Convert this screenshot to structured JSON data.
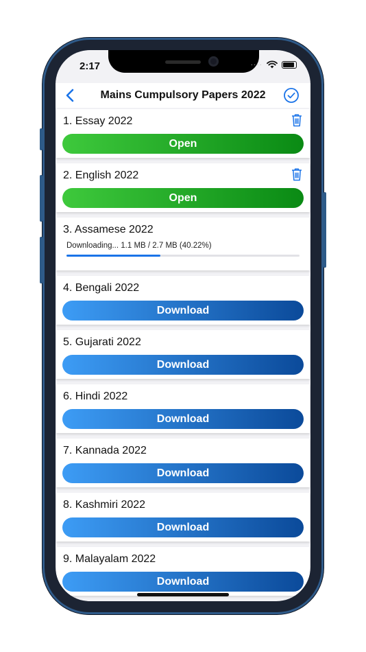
{
  "status": {
    "time": "2:17",
    "signal": "····"
  },
  "header": {
    "title": "Mains Cumpulsory Papers 2022"
  },
  "papers": [
    {
      "title": "1.  Essay 2022",
      "state": "open",
      "button": "Open"
    },
    {
      "title": "2.  English 2022",
      "state": "open",
      "button": "Open"
    },
    {
      "title": "3.  Assamese 2022",
      "state": "downloading",
      "progress_text": "Downloading... 1.1 MB / 2.7 MB (40.22%)",
      "progress": 0.4022
    },
    {
      "title": "4.  Bengali 2022",
      "state": "download",
      "button": "Download"
    },
    {
      "title": "5.  Gujarati 2022",
      "state": "download",
      "button": "Download"
    },
    {
      "title": "6.  Hindi 2022",
      "state": "download",
      "button": "Download"
    },
    {
      "title": "7.  Kannada 2022",
      "state": "download",
      "button": "Download"
    },
    {
      "title": "8.  Kashmiri 2022",
      "state": "download",
      "button": "Download"
    },
    {
      "title": "9.  Malayalam 2022",
      "state": "download",
      "button": "Download"
    }
  ],
  "colors": {
    "accent": "#1a73e8",
    "open_start": "#3ec93c",
    "open_end": "#0a8a14",
    "download_start": "#3d9cf5",
    "download_end": "#0b4a9a",
    "frame": "#2f5b8a"
  },
  "icons": {
    "back": "chevron-left-icon",
    "confirm": "checkmark-circle-icon",
    "delete": "trash-icon"
  }
}
